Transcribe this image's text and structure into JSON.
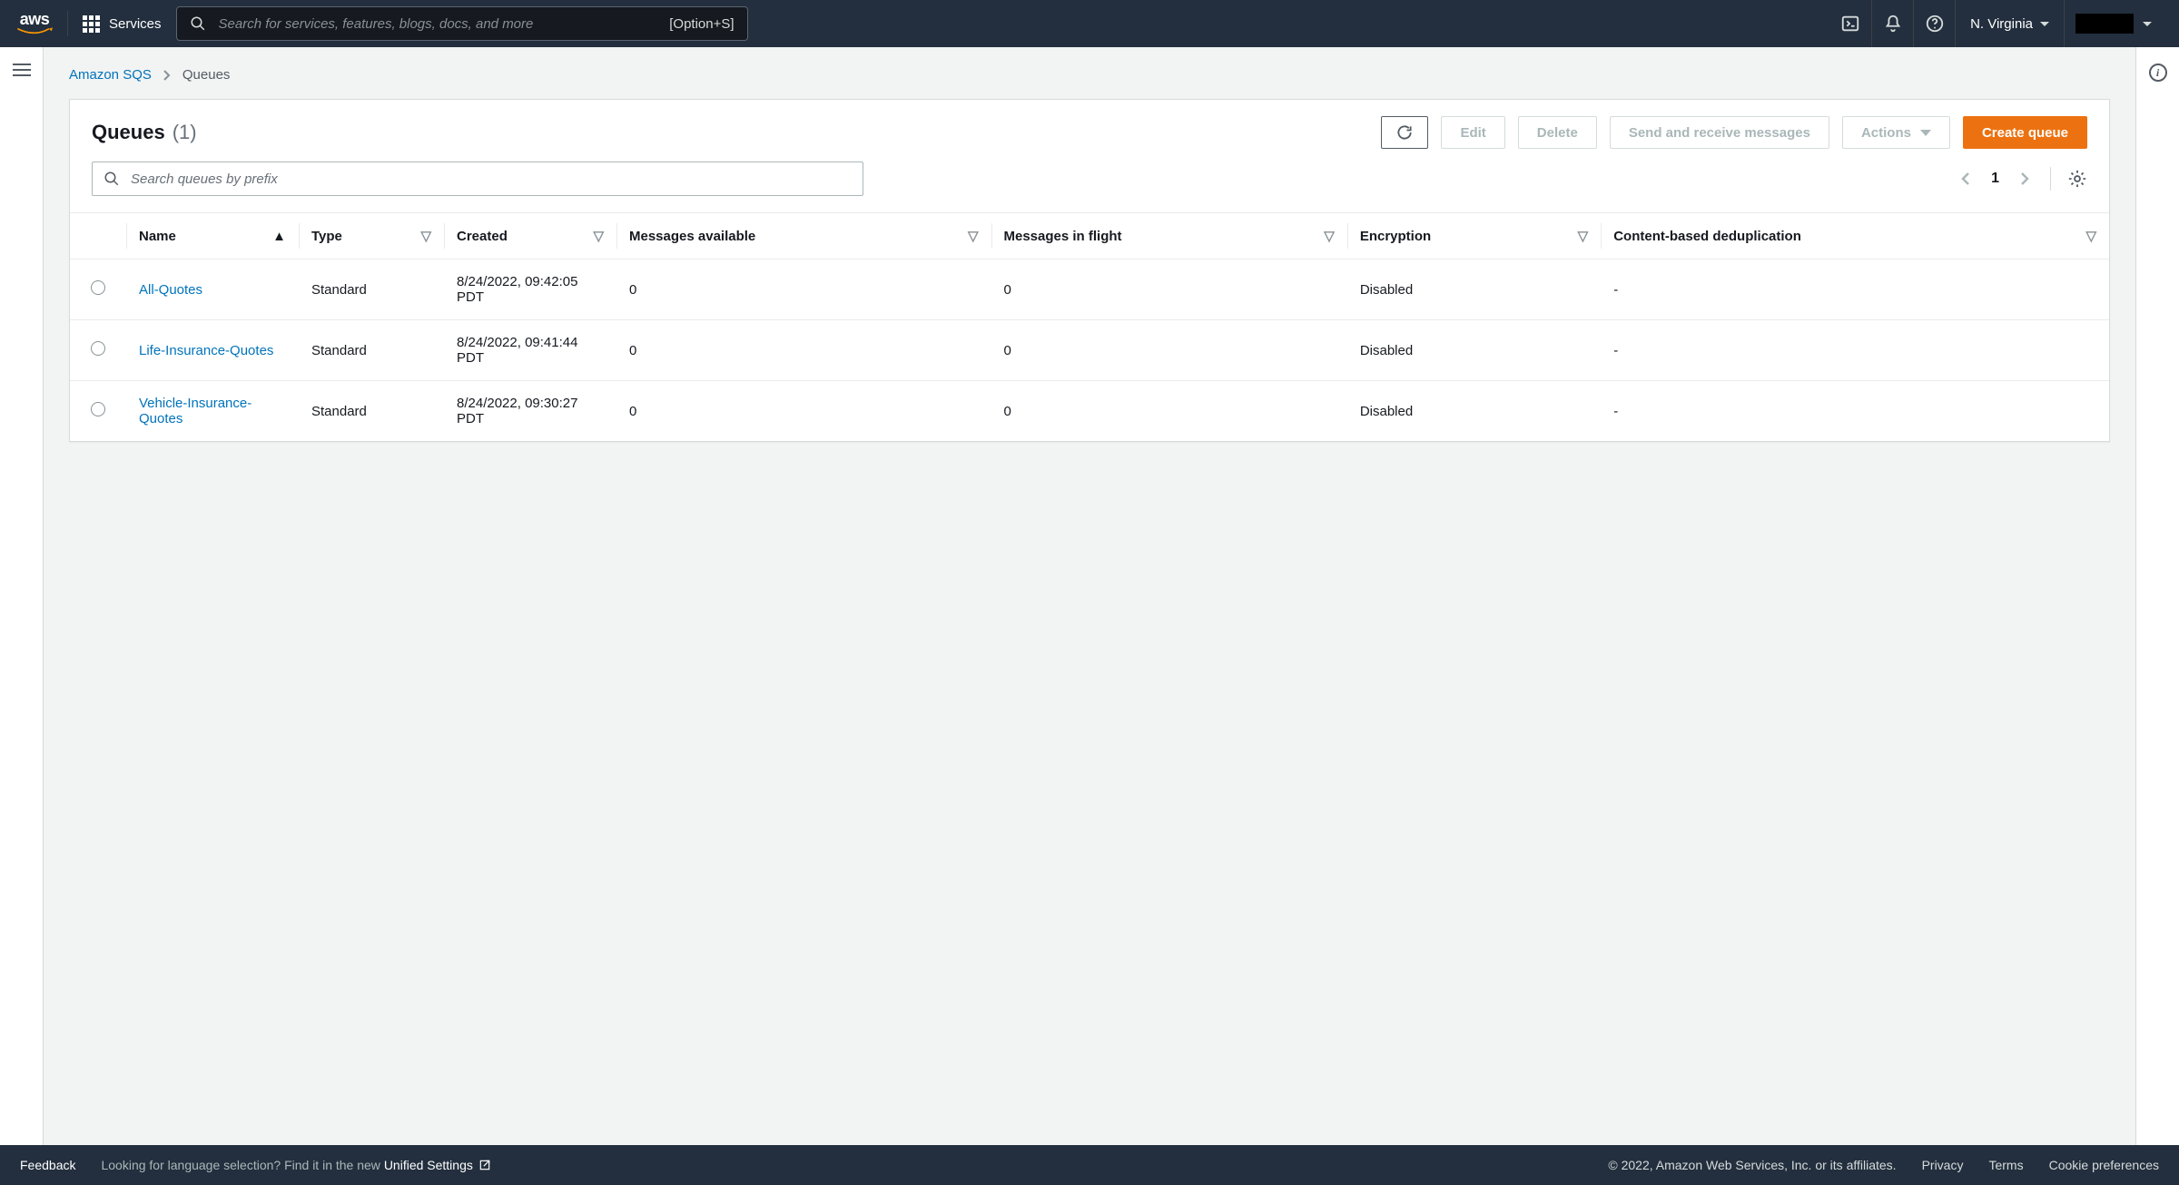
{
  "topnav": {
    "services_label": "Services",
    "search_placeholder": "Search for services, features, blogs, docs, and more",
    "search_shortcut": "[Option+S]",
    "region": "N. Virginia"
  },
  "breadcrumb": {
    "service": "Amazon SQS",
    "current": "Queues"
  },
  "panel": {
    "title": "Queues",
    "count": "(1)",
    "actions": {
      "edit": "Edit",
      "delete": "Delete",
      "send_receive": "Send and receive messages",
      "actions": "Actions",
      "create": "Create queue"
    },
    "search_placeholder": "Search queues by prefix",
    "page": "1"
  },
  "table": {
    "columns": {
      "name": "Name",
      "type": "Type",
      "created": "Created",
      "messages_available": "Messages available",
      "messages_in_flight": "Messages in flight",
      "encryption": "Encryption",
      "dedup": "Content-based deduplication"
    },
    "rows": [
      {
        "name": "All-Quotes",
        "type": "Standard",
        "created": "8/24/2022, 09:42:05 PDT",
        "messages_available": "0",
        "messages_in_flight": "0",
        "encryption": "Disabled",
        "dedup": "-"
      },
      {
        "name": "Life-Insurance-Quotes",
        "type": "Standard",
        "created": "8/24/2022, 09:41:44 PDT",
        "messages_available": "0",
        "messages_in_flight": "0",
        "encryption": "Disabled",
        "dedup": "-"
      },
      {
        "name": "Vehicle-Insurance-Quotes",
        "type": "Standard",
        "created": "8/24/2022, 09:30:27 PDT",
        "messages_available": "0",
        "messages_in_flight": "0",
        "encryption": "Disabled",
        "dedup": "-"
      }
    ]
  },
  "footer": {
    "feedback": "Feedback",
    "lang_prompt": "Looking for language selection? Find it in the new ",
    "unified_settings": "Unified Settings",
    "copyright": "© 2022, Amazon Web Services, Inc. or its affiliates.",
    "privacy": "Privacy",
    "terms": "Terms",
    "cookies": "Cookie preferences"
  }
}
